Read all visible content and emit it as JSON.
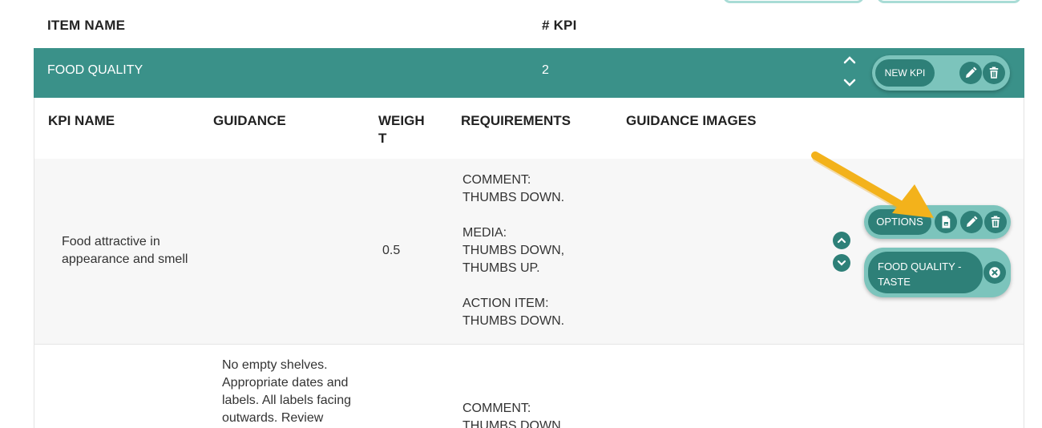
{
  "table_header": {
    "item_name": "ITEM NAME",
    "kpi_count": "# KPI"
  },
  "group": {
    "name": "FOOD QUALITY",
    "count": "2",
    "new_kpi_label": "NEW KPI"
  },
  "kpi_columns": {
    "kpi_name": "KPI NAME",
    "guidance": "GUIDANCE",
    "weight_line1": "WEIGH",
    "weight_line2": "T",
    "requirements": "REQUIREMENTS",
    "guidance_images": "GUIDANCE IMAGES"
  },
  "kpi_rows": [
    {
      "name_line1": "Food attractive in",
      "name_line2": "appearance and smell",
      "weight": "0.5",
      "requirements": [
        "COMMENT:",
        "THUMBS DOWN.",
        "MEDIA:",
        "THUMBS DOWN,",
        "THUMBS UP.",
        "ACTION ITEM:",
        "THUMBS DOWN."
      ],
      "options_label": "OPTIONS",
      "tag_line1": "FOOD QUALITY -",
      "tag_line2": "TASTE"
    },
    {
      "guidance": [
        "No empty shelves.",
        "Appropriate dates and",
        "labels. All labels facing",
        "outwards. Review"
      ],
      "requirements": [
        "COMMENT:",
        "THUMBS DOWN."
      ]
    }
  ],
  "colors": {
    "teal": "#3a9189",
    "teal_dark": "#2e8078",
    "teal_light": "#7cc4bc",
    "arrow": "#f3b21b"
  },
  "icons": [
    "chevron-up-icon",
    "chevron-down-icon",
    "pencil-icon",
    "trash-icon",
    "document-icon",
    "close-circle-icon"
  ]
}
